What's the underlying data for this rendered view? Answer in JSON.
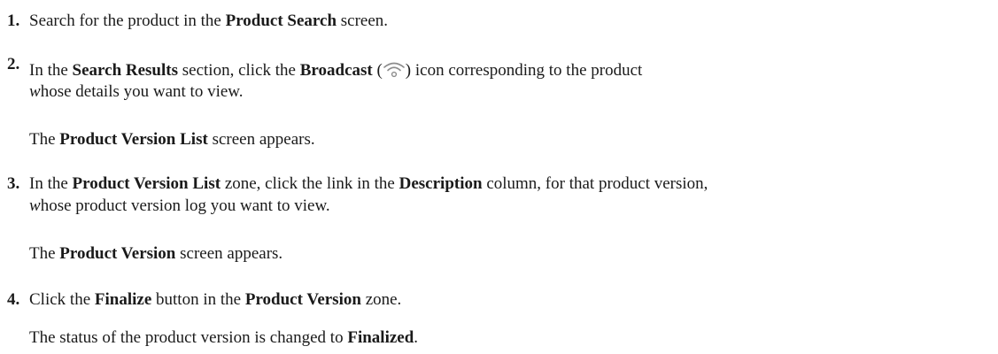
{
  "steps": [
    {
      "number": "1.",
      "lines": [
        {
          "pre": "Search for the product in the ",
          "b1": "Product Search",
          "post": " screen."
        }
      ]
    },
    {
      "number": "2.",
      "lines": [
        {
          "pre": "In the ",
          "b1": "Search Results",
          "mid": " section, click the ",
          "b2": "Broadcast",
          "open": " (",
          "close": ") icon corresponding to the product"
        },
        {
          "ital": "w",
          "rest": "hose details you want to view."
        }
      ],
      "icon": "broadcast-icon",
      "result": {
        "pre": "The ",
        "b1": "Product Version List",
        "post": " screen appears."
      }
    },
    {
      "number": "3.",
      "lines": [
        {
          "pre": "In the ",
          "b1": "Product Version List",
          "mid": " zone, click the link in the ",
          "b2": "Description",
          "post": " column, for that product version,"
        },
        {
          "ital": "w",
          "rest": "hose product version log you want to view."
        }
      ],
      "result": {
        "pre": "The ",
        "b1": "Product Version",
        "post": " screen appears."
      }
    },
    {
      "number": "4.",
      "lines": [
        {
          "pre": "Click the ",
          "b1": "Finalize",
          "mid": " button in the ",
          "b2": "Product Version",
          "post": " zone."
        }
      ],
      "result": {
        "pre": "The status of the product version is changed to ",
        "b1": "Finalized",
        "post": "."
      }
    }
  ]
}
